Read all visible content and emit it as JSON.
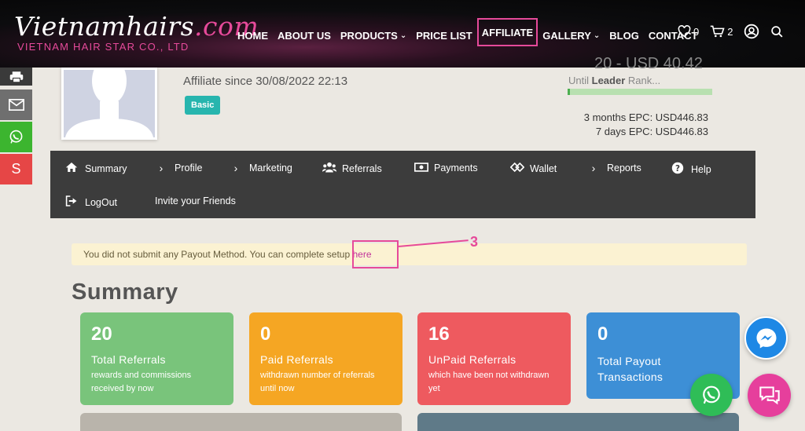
{
  "header": {
    "logo_main": "Vietnamhairs",
    "logo_dot": ".com",
    "logo_sub": "VIETNAM HAIR STAR CO., LTD",
    "nav": [
      {
        "label": "HOME"
      },
      {
        "label": "ABOUT US"
      },
      {
        "label": "PRODUCTS"
      },
      {
        "label": "PRICE LIST"
      },
      {
        "label": "AFFILIATE"
      },
      {
        "label": "GALLERY"
      },
      {
        "label": "BLOG"
      },
      {
        "label": "CONTACT"
      }
    ],
    "wishlist_count": "0",
    "cart_count": "2"
  },
  "side_bar": {
    "s_label": "S",
    "colors": {
      "print": "#3a3a3a",
      "email": "#6f6f6f",
      "whatsapp": "#3cb52f",
      "s": "#e64646"
    }
  },
  "profile": {
    "since": "Affiliate since 30/08/2022 22:13",
    "badge": "Basic",
    "rank_cut": "20 - USD 40.42",
    "rank_until": "Until",
    "rank_name": "Leader",
    "rank_suffix": "Rank...",
    "epc_3m": "3 months EPC: USD446.83",
    "epc_7d": "7 days EPC: USD446.83"
  },
  "menu": {
    "summary": "Summary",
    "profile": "Profile",
    "marketing": "Marketing",
    "referrals": "Referrals",
    "payments": "Payments",
    "wallet": "Wallet",
    "reports": "Reports",
    "help": "Help",
    "logout": "LogOut",
    "invite": "Invite your Friends"
  },
  "notice": {
    "text": "You did not submit any Payout Method. You can complete setup ",
    "link": "here",
    "annotation": "3"
  },
  "summary": {
    "title": "Summary",
    "cards": [
      {
        "num": "20",
        "title": "Total Referrals",
        "desc": "rewards and commissions received by now",
        "color": "#79c47b"
      },
      {
        "num": "0",
        "title": "Paid Referrals",
        "desc": "withdrawn number of referrals until now",
        "color": "#f5a623"
      },
      {
        "num": "16",
        "title": "UnPaid Referrals",
        "desc": "which have been not withdrawn yet",
        "color": "#ee5a5f"
      },
      {
        "num": "0",
        "title": "Total Payout Transactions",
        "desc": "",
        "color": "#3d8fd6"
      }
    ]
  },
  "colors": {
    "accent": "#e64a9a",
    "menu_bg": "#3c3c3c",
    "notice_bg": "#fbf2d2"
  }
}
